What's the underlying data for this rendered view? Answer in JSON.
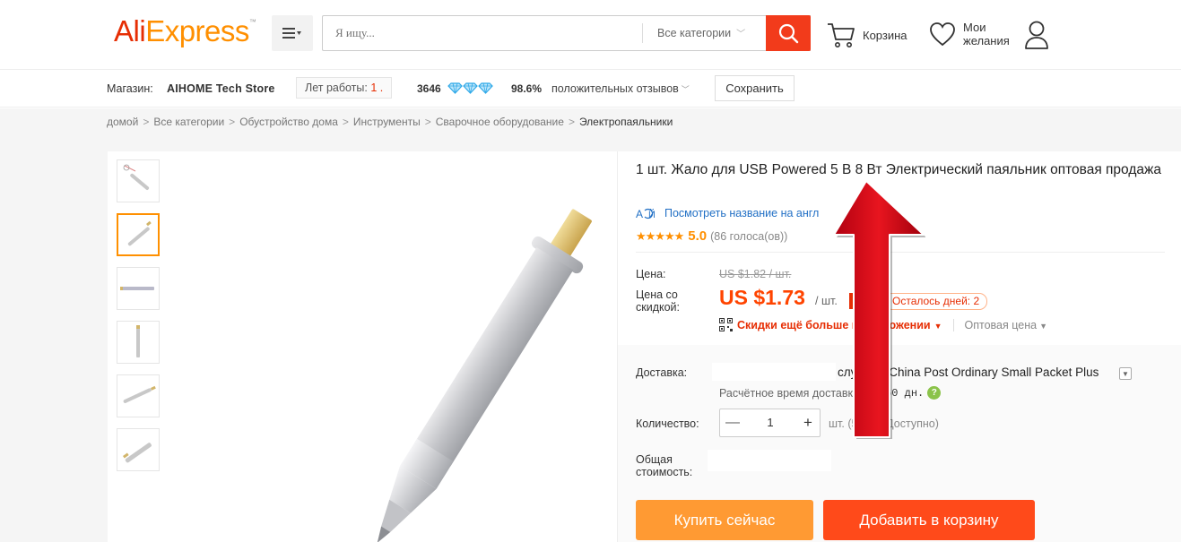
{
  "header": {
    "logo_ali": "Ali",
    "logo_express": "Express",
    "logo_tm": "™",
    "search_placeholder": "Я ищу...",
    "category_select": "Все категории",
    "cart_label": "Корзина",
    "wishlist_line1": "Мои",
    "wishlist_line2": "желания"
  },
  "store": {
    "label": "Магазин:",
    "name": "AIHOME Tech Store",
    "years_label": "Лет работы:",
    "years_value": "1 .",
    "score": "3646",
    "positive_pct": "98.6%",
    "positive_label": "положительных отзывов",
    "save_label": "Сохранить"
  },
  "breadcrumb": [
    "домой",
    "Все категории",
    "Обустройство дома",
    "Инструменты",
    "Сварочное оборудование",
    "Электропаяльники"
  ],
  "product": {
    "title": "1 шт. Жало для USB Powered 5 В 8 Вт Электрический паяльник оптовая продажа",
    "translate_link": "Посмотреть название на англ",
    "rating": "5.0",
    "votes": "(86 голоса(ов))",
    "price_label": "Цена:",
    "old_price": "US $1.82 / шт.",
    "discount_label": "Цена со скидкой:",
    "new_price": "US $1.73",
    "per_unit": "/ шт.",
    "discount_pct": "-5%",
    "days_left": "Осталось дней: 2",
    "app_deal": "Скидки ещё больше в приложении",
    "wholesale": "Оптовая цена",
    "shipping_label": "Доставка:",
    "shipping_method": "службой China Post Ordinary Small Packet Plus",
    "eta_label": "Расчётное время доставки:",
    "eta_value": "42-60 дн.",
    "quantity_label": "Количество:",
    "quantity_value": "1",
    "available": "шт. (51 шт. Доступно)",
    "total_label": "Общая стоимость:",
    "buy_now": "Купить сейчас",
    "add_to_cart": "Добавить в корзину"
  },
  "colors": {
    "brand_red": "#e62e04",
    "brand_orange": "#ff8f00",
    "price_red": "#ff4400",
    "buy_button": "#ff9a33",
    "cart_button": "#ff4a1a",
    "link_blue": "#2270c5",
    "diamond_blue": "#2fa9e8"
  },
  "icons": {
    "menu": "hamburger-menu-icon",
    "search": "magnifier-icon",
    "cart": "shopping-cart-icon",
    "wishlist": "heart-icon",
    "account": "user-icon",
    "diamond": "diamond-icon",
    "translate": "translate-icon",
    "qr": "qr-code-icon",
    "help": "question-icon",
    "annotation": "red-arrow-up-icon"
  },
  "gallery": {
    "thumb_count": 6,
    "active_thumb": 2
  }
}
